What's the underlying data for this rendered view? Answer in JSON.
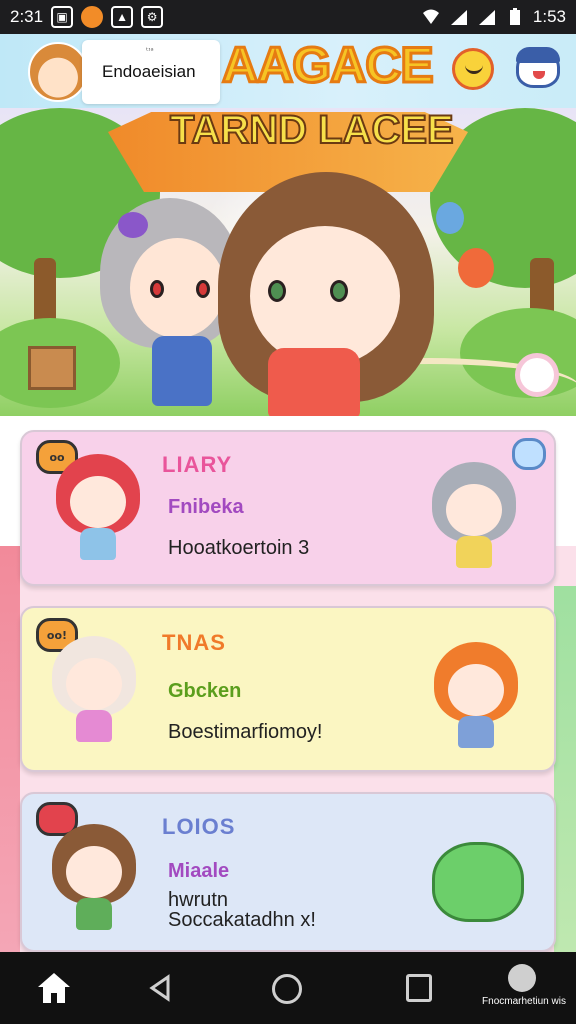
{
  "status_bar": {
    "time_left": "2:31",
    "time_right": "1:53",
    "icons": [
      "photo-icon",
      "orange-app-icon",
      "upload-icon",
      "gear-icon",
      "wifi-icon",
      "signal-icon",
      "battery-icon"
    ]
  },
  "header": {
    "user_small": "ᵗᶦᵃ",
    "user_name": "Endoaeisian",
    "title_top": "AAGACE"
  },
  "hero": {
    "title": "TARND LACEE"
  },
  "cards": [
    {
      "tag": "LIARY",
      "subtitle": "Fnibeka",
      "description": "Hooatkoertoin 3",
      "tag_color": "#e9559b",
      "sub_color": "#a24ac0",
      "bubble": "oo"
    },
    {
      "tag": "TNAS",
      "subtitle": "Gbcken",
      "description": "Boestimarfiomoy!",
      "tag_color": "#f07a2a",
      "sub_color": "#5b9e1d",
      "bubble": "oo!"
    },
    {
      "tag": "LOIOS",
      "subtitle": "Miaale",
      "description_line1": "hwrutn",
      "description_line2": "Soccakatadhn x!",
      "tag_color": "#6a7fd0",
      "sub_color": "#a24ac0",
      "bubble": ""
    }
  ],
  "nav": {
    "bot_label": "Fnocmarhetiun wis"
  }
}
